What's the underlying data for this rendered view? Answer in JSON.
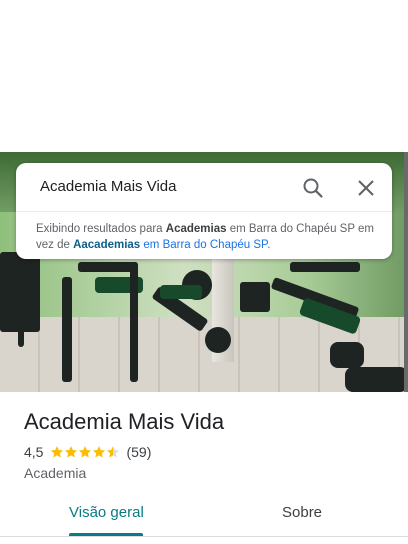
{
  "search": {
    "query": "Academia Mais Vida",
    "suggestion_prefix": "Exibindo resultados para ",
    "suggestion_term": "Academias",
    "suggestion_mid": " em Barra do Chapéu SP em vez de ",
    "original_term": "Aacademias",
    "original_suffix": " em Barra do Chapéu SP."
  },
  "place": {
    "name": "Academia Mais Vida",
    "rating": "4,5",
    "rating_value": 4.5,
    "review_count": "(59)",
    "category": "Academia"
  },
  "tabs": [
    {
      "label": "Visão geral",
      "active": true
    },
    {
      "label": "Sobre",
      "active": false
    }
  ],
  "colors": {
    "accent": "#0b7a83",
    "star": "#fbbc04",
    "link": "#1a73e8"
  },
  "icons": {
    "search": "search-icon",
    "close": "close-icon",
    "star": "star-icon"
  }
}
